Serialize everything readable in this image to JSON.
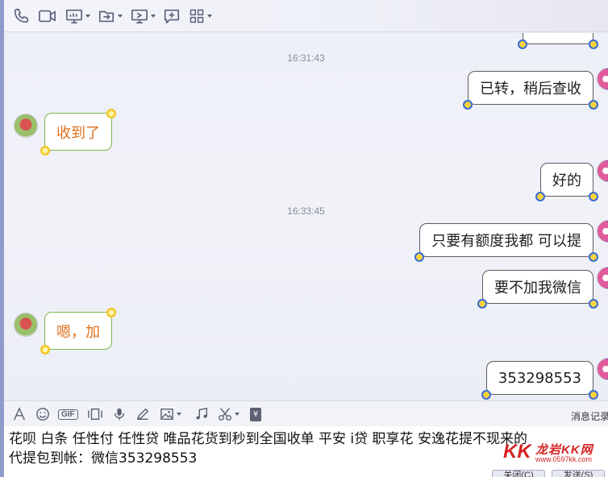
{
  "toolbar": {
    "buttons": [
      "phone-icon",
      "video-icon",
      "screen-share-icon",
      "file-transfer-icon",
      "remote-desktop-icon",
      "add-icon",
      "apps-icon"
    ]
  },
  "chat": {
    "timestamp_1": "16:31:43",
    "timestamp_2": "16:33:45",
    "messages": [
      {
        "side": "right",
        "text": "已转，稍后查收"
      },
      {
        "side": "left",
        "text": "收到了"
      },
      {
        "side": "right",
        "text": "好的"
      },
      {
        "side": "right",
        "text": "只要有额度我都 可以提"
      },
      {
        "side": "right",
        "text": "要不加我微信"
      },
      {
        "side": "left",
        "text": "嗯，加"
      },
      {
        "side": "right",
        "text": "353298553"
      }
    ]
  },
  "input_toolbar": {
    "tools": [
      "font-icon",
      "emoji-icon",
      "gif-icon",
      "screenshot-icon",
      "mic-icon",
      "pen-icon",
      "image-icon",
      "music-icon",
      "scissors-icon",
      "red-packet-icon"
    ],
    "gif_label": "GIF",
    "red_packet_label": "¥",
    "history_label": "消息记录"
  },
  "input": {
    "line1": "花呗 白条 任性付  任性贷 唯品花货到秒到全国收单 平安 i贷  职享花  安逸花提不现来的",
    "line2": "代提包到帐：微信353298553"
  },
  "watermark": {
    "title": "龙岩KK网",
    "url": "www.0597kk.com",
    "logo": "KK"
  },
  "buttons": {
    "close_label": "关闭(C)",
    "send_label": "发送(S)"
  }
}
